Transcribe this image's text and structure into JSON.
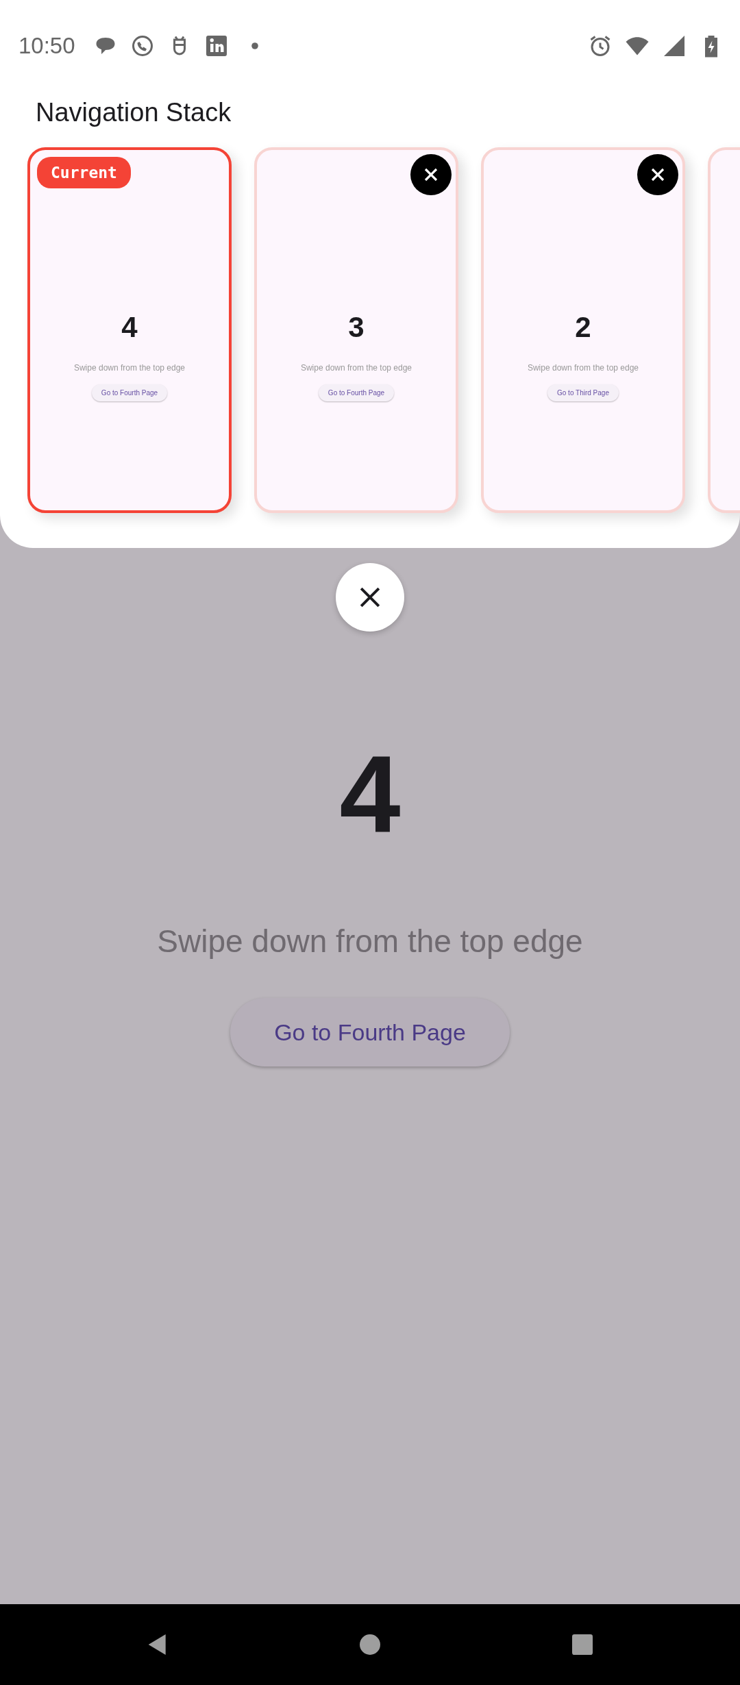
{
  "status_bar": {
    "time": "10:50"
  },
  "sheet": {
    "title": "Navigation Stack",
    "pages": [
      {
        "selected": true,
        "badge": "Current",
        "number": "4",
        "hint": "Swipe down from the top edge",
        "button": "Go to Fourth Page"
      },
      {
        "selected": false,
        "number": "3",
        "hint": "Swipe down from the top edge",
        "button": "Go to Fourth Page"
      },
      {
        "selected": false,
        "number": "2",
        "hint": "Swipe down from the top edge",
        "button": "Go to Third Page"
      }
    ]
  },
  "page": {
    "number": "4",
    "hint": "Swipe down from the top edge",
    "button": "Go to Fourth Page"
  }
}
